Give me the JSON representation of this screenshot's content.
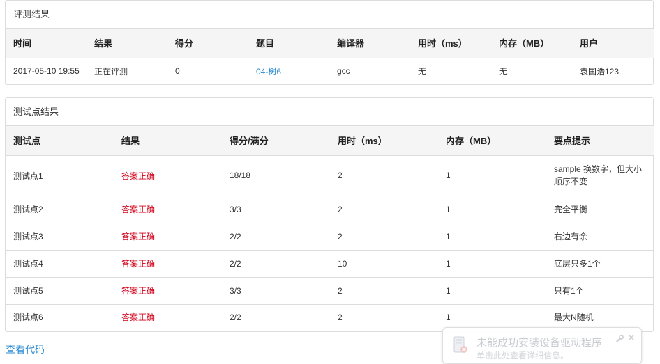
{
  "result_panel": {
    "title": "评测结果",
    "headers": [
      "时间",
      "结果",
      "得分",
      "题目",
      "编译器",
      "用时（ms）",
      "内存（MB）",
      "用户"
    ],
    "row": {
      "time": "2017-05-10 19:55",
      "result": "正在评测",
      "score": "0",
      "problem": "04-树6",
      "compiler": "gcc",
      "time_used": "无",
      "memory": "无",
      "user": "袁国浩123"
    }
  },
  "testcase_panel": {
    "title": "测试点结果",
    "headers": [
      "测试点",
      "结果",
      "得分/满分",
      "用时（ms）",
      "内存（MB）",
      "要点提示"
    ],
    "rows": [
      {
        "case": "测试点1",
        "result": "答案正确",
        "score": "18/18",
        "time": "2",
        "memory": "1",
        "hint": "sample 换数字，但大小顺序不变"
      },
      {
        "case": "测试点2",
        "result": "答案正确",
        "score": "3/3",
        "time": "2",
        "memory": "1",
        "hint": "完全平衡"
      },
      {
        "case": "测试点3",
        "result": "答案正确",
        "score": "2/2",
        "time": "2",
        "memory": "1",
        "hint": "右边有余"
      },
      {
        "case": "测试点4",
        "result": "答案正确",
        "score": "2/2",
        "time": "10",
        "memory": "1",
        "hint": "底层只多1个"
      },
      {
        "case": "测试点5",
        "result": "答案正确",
        "score": "3/3",
        "time": "2",
        "memory": "1",
        "hint": "只有1个"
      },
      {
        "case": "测试点6",
        "result": "答案正确",
        "score": "2/2",
        "time": "2",
        "memory": "1",
        "hint": "最大N随机"
      }
    ]
  },
  "view_code_link": "查看代码",
  "notification": {
    "title": "未能成功安装设备驱动程序",
    "subtitle": "单击此处查看详细信息。",
    "icon": "driver-warning-icon"
  },
  "colors": {
    "link": "#2a8bd2",
    "accepted": "#d0021b",
    "header_bg": "#f5f5f5",
    "border": "#dcdcdc"
  }
}
